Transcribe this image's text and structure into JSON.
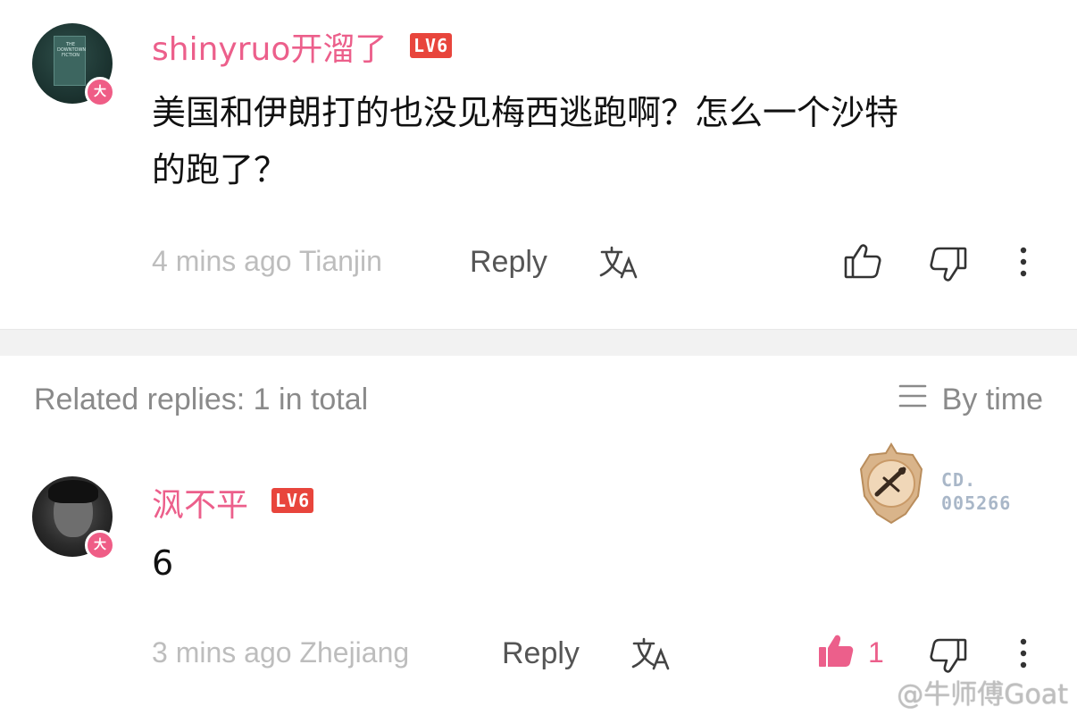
{
  "comment": {
    "username": "shinyruo开溜了",
    "level": "LV6",
    "avatar_badge": "大",
    "avatar_book_text": "THE DOWNTOWN FICTION",
    "text_line1": "美国和伊朗打的也没见梅西逃跑啊？怎么一个沙特",
    "text_line2": "的跑了？",
    "time": "4 mins ago",
    "location": "Tianjin",
    "reply_label": "Reply",
    "icons": [
      "translate-icon",
      "thumbs-up-icon",
      "thumbs-down-icon",
      "more-icon"
    ]
  },
  "related": {
    "label": "Related replies: 1 in total",
    "sort_label": "By time",
    "sort_icon": "list-icon"
  },
  "reply": {
    "username": "沨不平",
    "level": "LV6",
    "avatar_badge": "大",
    "text": "6",
    "time": "3 mins ago",
    "location": "Zhejiang",
    "reply_label": "Reply",
    "like_count": "1",
    "medal_code_line1": "CD.",
    "medal_code_line2": "005266",
    "icons": [
      "translate-icon",
      "thumbs-up-filled-icon",
      "thumbs-down-icon",
      "more-icon",
      "medal-icon"
    ]
  },
  "watermark": "@牛师傅Goat",
  "colors": {
    "username": "#ec5f8b",
    "level_badge": "#e8453c",
    "meta_text": "#bdbdbd",
    "like_active": "#ec5f8b"
  }
}
